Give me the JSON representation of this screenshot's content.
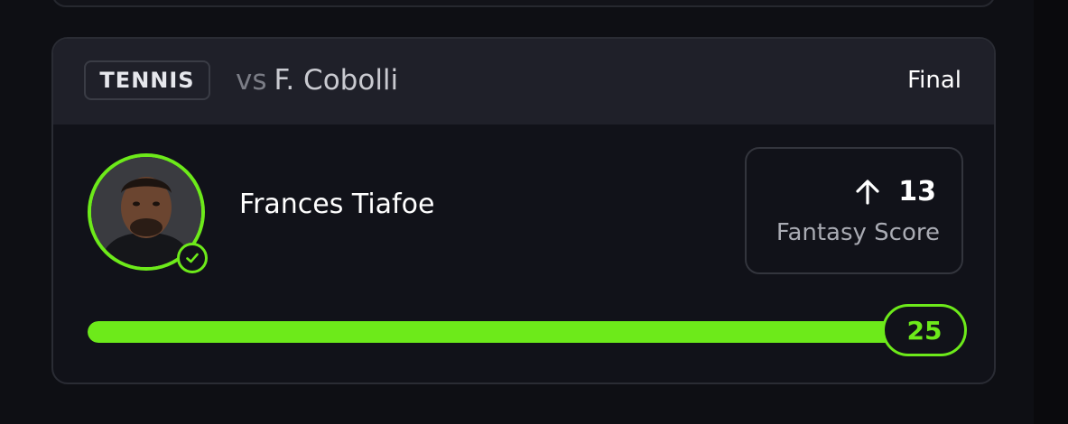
{
  "header": {
    "sport": "TENNIS",
    "vs_prefix": "vs",
    "opponent": "F. Cobolli",
    "status": "Final"
  },
  "player": {
    "name": "Frances Tiafoe"
  },
  "score": {
    "direction": "arrow-up-icon",
    "value": "13",
    "label": "Fantasy Score"
  },
  "progress": {
    "line": "25",
    "fill_fraction": 1.0
  },
  "colors": {
    "accent": "#6dea1a",
    "background": "#0e0f14",
    "card": "#111219",
    "header": "#1f2029"
  }
}
